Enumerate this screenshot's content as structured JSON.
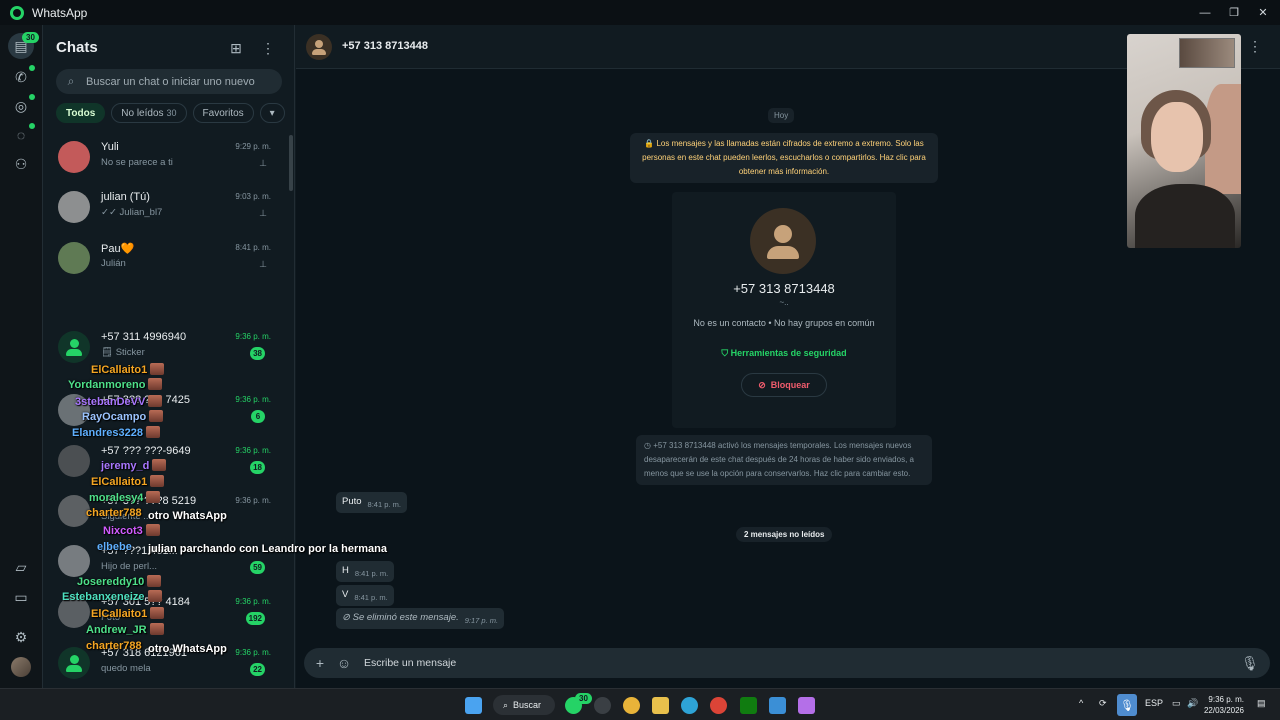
{
  "window": {
    "title": "WhatsApp",
    "controls": [
      "—",
      "❐",
      "✕"
    ]
  },
  "rail": {
    "chats_badge": "30",
    "icons": [
      "chats-icon",
      "calls-icon",
      "status-icon",
      "channels-icon",
      "communities-icon",
      "media-icon",
      "starred-icon",
      "settings-icon",
      "profile-avatar"
    ]
  },
  "sidebar": {
    "title": "Chats",
    "search_placeholder": "Buscar un chat o iniciar uno nuevo",
    "filters": [
      {
        "label": "Todos",
        "count": ""
      },
      {
        "label": "No leídos",
        "count": "30"
      },
      {
        "label": "Favoritos",
        "count": ""
      },
      {
        "label": "▾",
        "count": ""
      }
    ],
    "chats": [
      {
        "name": "Yuli",
        "preview": "No se parece a ti",
        "time": "9:29 p. m.",
        "pinned": true,
        "unread": ""
      },
      {
        "name": "julian (Tú)",
        "preview": "✓✓ Julian_bl7",
        "time": "9:03 p. m.",
        "pinned": true,
        "unread": ""
      },
      {
        "name": "Pau🧡",
        "preview": "Julián",
        "time": "8:41 p. m.",
        "pinned": true,
        "unread": ""
      },
      {
        "name": "+57 311 4996940",
        "preview": "🗒 Sticker",
        "time": "9:36 p. m.",
        "pinned": false,
        "unread": "38"
      },
      {
        "name": "+57 3?? ?61 7425",
        "preview": "",
        "time": "9:36 p. m.",
        "pinned": false,
        "unread": "6"
      },
      {
        "name": "+57 ??? ???-9649",
        "preview": "",
        "time": "9:36 p. m.",
        "pinned": false,
        "unread": "18"
      },
      {
        "name": "+57 3?? ???8 5219",
        "preview": "Siguiente ...",
        "time": "9:36 p. m.",
        "pinned": false,
        "unread": ""
      },
      {
        "name": "+57 ???1 461...",
        "preview": "Hijo de perl...",
        "time": "",
        "pinned": false,
        "unread": "59"
      },
      {
        "name": "+57 301 5?? 4184",
        "preview": "Foto",
        "time": "9:36 p. m.",
        "pinned": false,
        "unread": "192"
      },
      {
        "name": "+57 318 6121961",
        "preview": "quedo mela",
        "time": "9:36 p. m.",
        "pinned": false,
        "unread": "22"
      }
    ]
  },
  "overlay": [
    {
      "text": "ElCallaito1",
      "color": "#f5a623",
      "emote": true
    },
    {
      "text": "Yordanmoreno",
      "color": "#4ee08a",
      "emote": true
    },
    {
      "text": "3stebanDeVV",
      "color": "#a977ff",
      "emote": true
    },
    {
      "text": "RayOcampo",
      "color": "#9bc4ff",
      "emote": true
    },
    {
      "text": "Elandres3228",
      "color": "#5fb0ff",
      "emote": true
    },
    {
      "text": "jeremy_d",
      "color": "#a977ff",
      "emote": true
    },
    {
      "text": "ElCallaito1",
      "color": "#f5a623",
      "emote": true
    },
    {
      "text": "moralesy4",
      "color": "#4ee08a",
      "emote": true
    },
    {
      "text": "charter788",
      "color": "#f5a623",
      "emote": false
    },
    {
      "text": "otro WhatsApp",
      "color": "#ffffff",
      "emote": false
    },
    {
      "text": "Nixcot3",
      "color": "#d25cff",
      "emote": true
    },
    {
      "text": "elbebe",
      "color": "#5fb0ff",
      "emote": false
    },
    {
      "text": "julian parchando con Leandro por la hermana",
      "color": "#ffffff",
      "emote": false
    },
    {
      "text": "Josereddy10",
      "color": "#4ee08a",
      "emote": true
    },
    {
      "text": "Estebanxeneize",
      "color": "#4ee0c0",
      "emote": true
    },
    {
      "text": "ElCallaito1",
      "color": "#f5a623",
      "emote": true
    },
    {
      "text": "Andrew_JR",
      "color": "#4ee08a",
      "emote": true
    },
    {
      "text": "charter788",
      "color": "#f5a623",
      "emote": false
    },
    {
      "text": "otro WhatsApp",
      "color": "#ffffff",
      "emote": false
    }
  ],
  "conversation": {
    "contact": "+57 313 8713448",
    "date_label": "Hoy",
    "encryption_notice": "🔒 Los mensajes y las llamadas están cifrados de extremo a extremo. Solo las personas en este chat pueden leerlos, escucharlos o compartirlos. Haz clic para obtener más información.",
    "card": {
      "phone": "+57 313 8713448",
      "sub": "~..",
      "info": "No es un contacto • No hay grupos en común",
      "security": "Herramientas de seguridad",
      "block": "Bloquear"
    },
    "ephemeral_notice": "+57 313 8713448 activó los mensajes temporales. Los mensajes nuevos desaparecerán de este chat después de 24 horas de haber sido enviados, a menos que se use la opción para conservarlos. Haz clic para cambiar esto.",
    "unread_divider": "2 mensajes no leídos",
    "messages": [
      {
        "text": "Puto",
        "time": "8:41 p. m.",
        "deleted": false
      },
      {
        "text": "H",
        "time": "8:41 p. m.",
        "deleted": false
      },
      {
        "text": "V",
        "time": "8:41 p. m.",
        "deleted": false
      },
      {
        "text": "Se eliminó este mensaje.",
        "time": "9:17 p. m.",
        "deleted": true
      }
    ],
    "composer_placeholder": "Escribe un mensaje"
  },
  "taskbar": {
    "search_label": "Buscar",
    "whatsapp_badge": "30",
    "lang": "ESP",
    "time": "9:36 p. m.",
    "date": "22/03/2026"
  },
  "colors": {
    "accent": "#25d366",
    "panel_bg": "#111b21",
    "conv_bg": "#0b141a",
    "danger": "#f15c6d",
    "notice": "#ffd279"
  }
}
